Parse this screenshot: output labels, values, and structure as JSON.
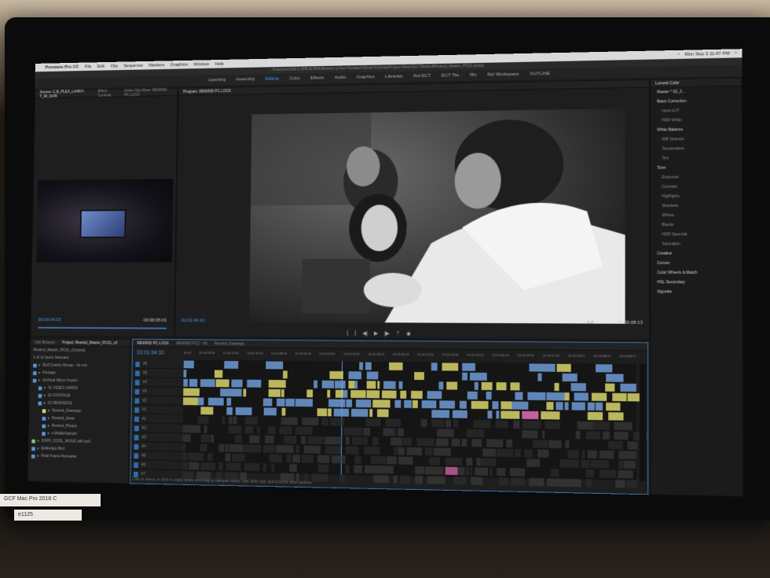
{
  "menubar": {
    "app_name": "Premiere Pro CC",
    "items": [
      "File",
      "Edit",
      "Clip",
      "Sequence",
      "Markers",
      "Graphics",
      "Window",
      "Help"
    ],
    "clock": "Mon Sep 3 11:47 PM"
  },
  "titlebar": "/Volumes/USB-C 4TB ALPHA/Rewind to Run Forward (World Archive)/Project Files/2017 Rewind/Rewind_Master_PC01.prproj",
  "workspaces": {
    "items": [
      "Learning",
      "Assembly",
      "Editing",
      "Color",
      "Effects",
      "Audio",
      "Graphics",
      "Libraries",
      "Ref ECT",
      "ECT Tile",
      "Rlx",
      "Ref Workspace",
      "OUTLINE"
    ],
    "active_index": 2
  },
  "source_panel": {
    "tabs": [
      "Source: C,B_PLEX_LANNY-T_IR_0045",
      "Effect Controls",
      "Audio Clip Mixer: REWIND PC LOCK"
    ],
    "timecode": "00:00:04:15",
    "duration": "00:00:05:01"
  },
  "program_panel": {
    "tab": "Program: REWIND PC LOCK",
    "timecode": "01:01:04:10",
    "fit": "Full",
    "duration": "00:00:08:13"
  },
  "lumetri": {
    "tab": "Lumetri Color",
    "items": [
      {
        "label": "Master * 02_3...",
        "kind": "head"
      },
      {
        "label": "Basic Correction",
        "kind": "head"
      },
      {
        "label": "Input LUT",
        "kind": "sub"
      },
      {
        "label": "HDR White",
        "kind": "sub"
      },
      {
        "label": "White Balance",
        "kind": "head"
      },
      {
        "label": "WB Selector",
        "kind": "sub"
      },
      {
        "label": "Temperature",
        "kind": "sub"
      },
      {
        "label": "Tint",
        "kind": "sub"
      },
      {
        "label": "Tone",
        "kind": "head"
      },
      {
        "label": "Exposure",
        "kind": "sub"
      },
      {
        "label": "Contrast",
        "kind": "sub"
      },
      {
        "label": "Highlights",
        "kind": "sub"
      },
      {
        "label": "Shadows",
        "kind": "sub"
      },
      {
        "label": "Whites",
        "kind": "sub"
      },
      {
        "label": "Blacks",
        "kind": "sub"
      },
      {
        "label": "HDR Specular",
        "kind": "sub"
      },
      {
        "label": "Saturation",
        "kind": "sub"
      },
      {
        "label": "Creative",
        "kind": "head"
      },
      {
        "label": "Curves",
        "kind": "head"
      },
      {
        "label": "Color Wheels & Match",
        "kind": "head"
      },
      {
        "label": "HSL Secondary",
        "kind": "head"
      },
      {
        "label": "Vignette",
        "kind": "head"
      }
    ]
  },
  "project_panel": {
    "tabs": [
      "Info Browser",
      "Project: Rewind_Master_PC01_v3"
    ],
    "project_file": "Rewind_Master_PC01_v3.prproj",
    "items_count": "1 of 11 Items Selected",
    "bins": [
      {
        "name": "Bull Cowdry Recap - Vo mix",
        "color": "#5b8fdc"
      },
      {
        "name": "Footage",
        "color": "#5b8fdc"
      },
      {
        "name": "Archival Album Import",
        "color": "#5b8fdc"
      },
      {
        "name": "01 VIDEO CARDS",
        "color": "#5b8fdc"
      },
      {
        "name": "02 FOOTAGE",
        "color": "#5b8fdc"
      },
      {
        "name": "03 REWIND(S)",
        "color": "#5b8fdc"
      },
      {
        "name": "Rewind_Drawings",
        "color": "#c9d36a"
      },
      {
        "name": "Rewind_Ideas",
        "color": "#5b8fdc"
      },
      {
        "name": "Rewind_Photos",
        "color": "#5b8fdc"
      },
      {
        "name": "x.MiddleSample",
        "color": "#5b8fdc"
      },
      {
        "name": "DSPF_COOL_MUSIC.aiff.mp3",
        "color": "#7ec66b"
      },
      {
        "name": "Editiorigin Bird",
        "color": "#5b8fdc"
      },
      {
        "name": "Final Frame Remaster",
        "color": "#5b8fdc"
      }
    ]
  },
  "timeline": {
    "tabs": [
      "REWIND PC LOCK",
      "REWIND PC2 - V3",
      "Rewind_Drawings"
    ],
    "timecode": "01:01:04:10",
    "ruler": [
      "00:00",
      "01:00:08:16",
      "01:00:23:00",
      "01:00:32:16",
      "01:00:48:00",
      "01:00:56:20",
      "01:01:03:22",
      "01:01:20:00",
      "01:01:28:04",
      "01:01:36:16",
      "01:01:52:00",
      "01:02:00:20",
      "01:02:13:12",
      "01:02:20:00",
      "01:02:28:16",
      "01:02:41:20",
      "01:03:00:07",
      "01:03:08:13",
      "01:03:08:17"
    ],
    "tracks": [
      "V6",
      "V5",
      "V4",
      "V3",
      "V2",
      "V1",
      "A1",
      "A2",
      "A3",
      "A4",
      "A5",
      "A6",
      "A7"
    ],
    "footer": "Click to select, or click in empty space and drag to marquee select. Use Shift, Opt, and Cmd for other options.",
    "colors": {
      "video_blue": "#6f9bd6",
      "video_yellow": "#d8d36b",
      "audio_green": "#79c29a",
      "pink": "#e36db5",
      "selection": "#4a9df0"
    }
  },
  "stickers": {
    "label1": "GCF  Mac Pro 2018 C",
    "label2": "e1125"
  }
}
